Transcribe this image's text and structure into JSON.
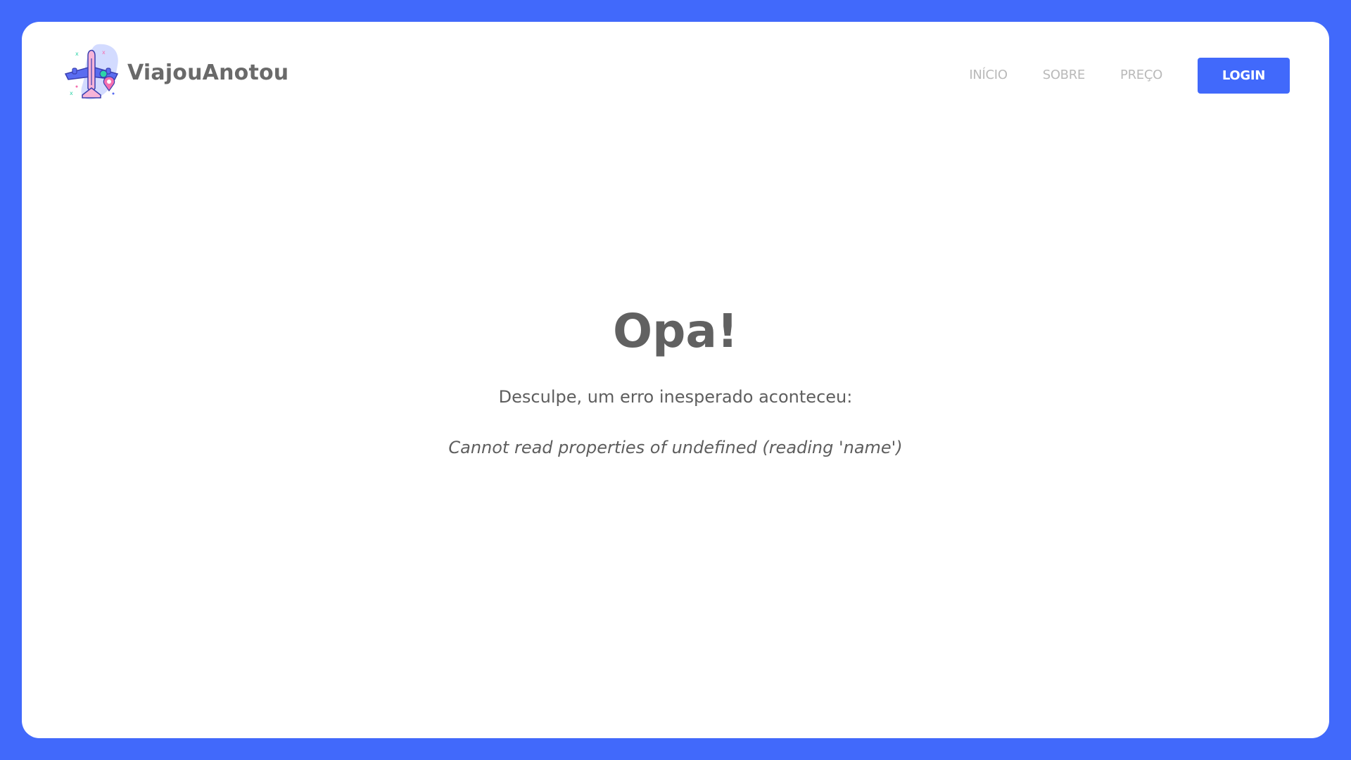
{
  "brand": {
    "name": "ViajouAnotou",
    "logo_icon": "airplane-location-pin-icon"
  },
  "nav": {
    "links": [
      {
        "label": "INÍCIO"
      },
      {
        "label": "SOBRE"
      },
      {
        "label": "PREÇO"
      }
    ],
    "login_label": "LOGIN"
  },
  "error": {
    "title": "Opa!",
    "message": "Desculpe, um erro inesperado aconteceu:",
    "detail": "Cannot read properties of undefined (reading 'name')"
  },
  "colors": {
    "accent": "#4169fb",
    "background": "#ffffff",
    "text": "#616161",
    "nav_text": "#b9b9b9"
  }
}
